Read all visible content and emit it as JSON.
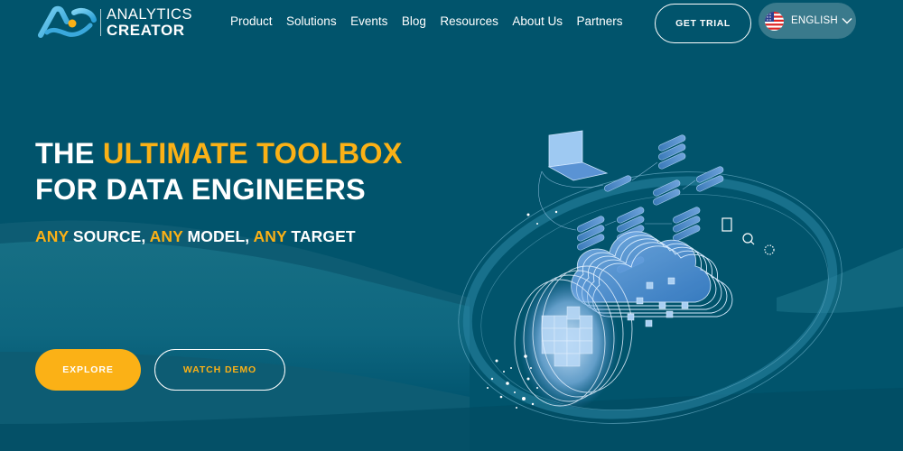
{
  "brand": {
    "name_line1": "ANALYTICS",
    "name_line2": "CREATOR",
    "logo_icon": "analytics-creator-logo"
  },
  "nav": {
    "items": [
      {
        "label": "Product"
      },
      {
        "label": "Solutions"
      },
      {
        "label": "Events"
      },
      {
        "label": "Blog"
      },
      {
        "label": "Resources"
      },
      {
        "label": "About Us"
      },
      {
        "label": "Partners"
      }
    ],
    "trial_label": "GET TRIAL",
    "language": {
      "label": "ENGLISH",
      "flag_icon": "us-flag-icon",
      "chevron_icon": "chevron-down-icon"
    }
  },
  "hero": {
    "title_line1_prefix": "THE ",
    "title_line1_accent": "ULTIMATE TOOLBOX",
    "title_line2": "FOR DATA ENGINEERS",
    "tagline": [
      {
        "text": "ANY",
        "accent": true
      },
      {
        "text": " SOURCE, ",
        "accent": false
      },
      {
        "text": "ANY",
        "accent": true
      },
      {
        "text": " MODEL, ",
        "accent": false
      },
      {
        "text": "ANY",
        "accent": true
      },
      {
        "text": " TARGET",
        "accent": false
      }
    ],
    "explore_label": "EXPLORE",
    "demo_label": "WATCH DEMO",
    "illustration": "data-cloud-illustration"
  },
  "colors": {
    "background": "#01536b",
    "accent": "#fbb116",
    "lang_pill": "#3a7a8c",
    "text": "#ffffff"
  }
}
